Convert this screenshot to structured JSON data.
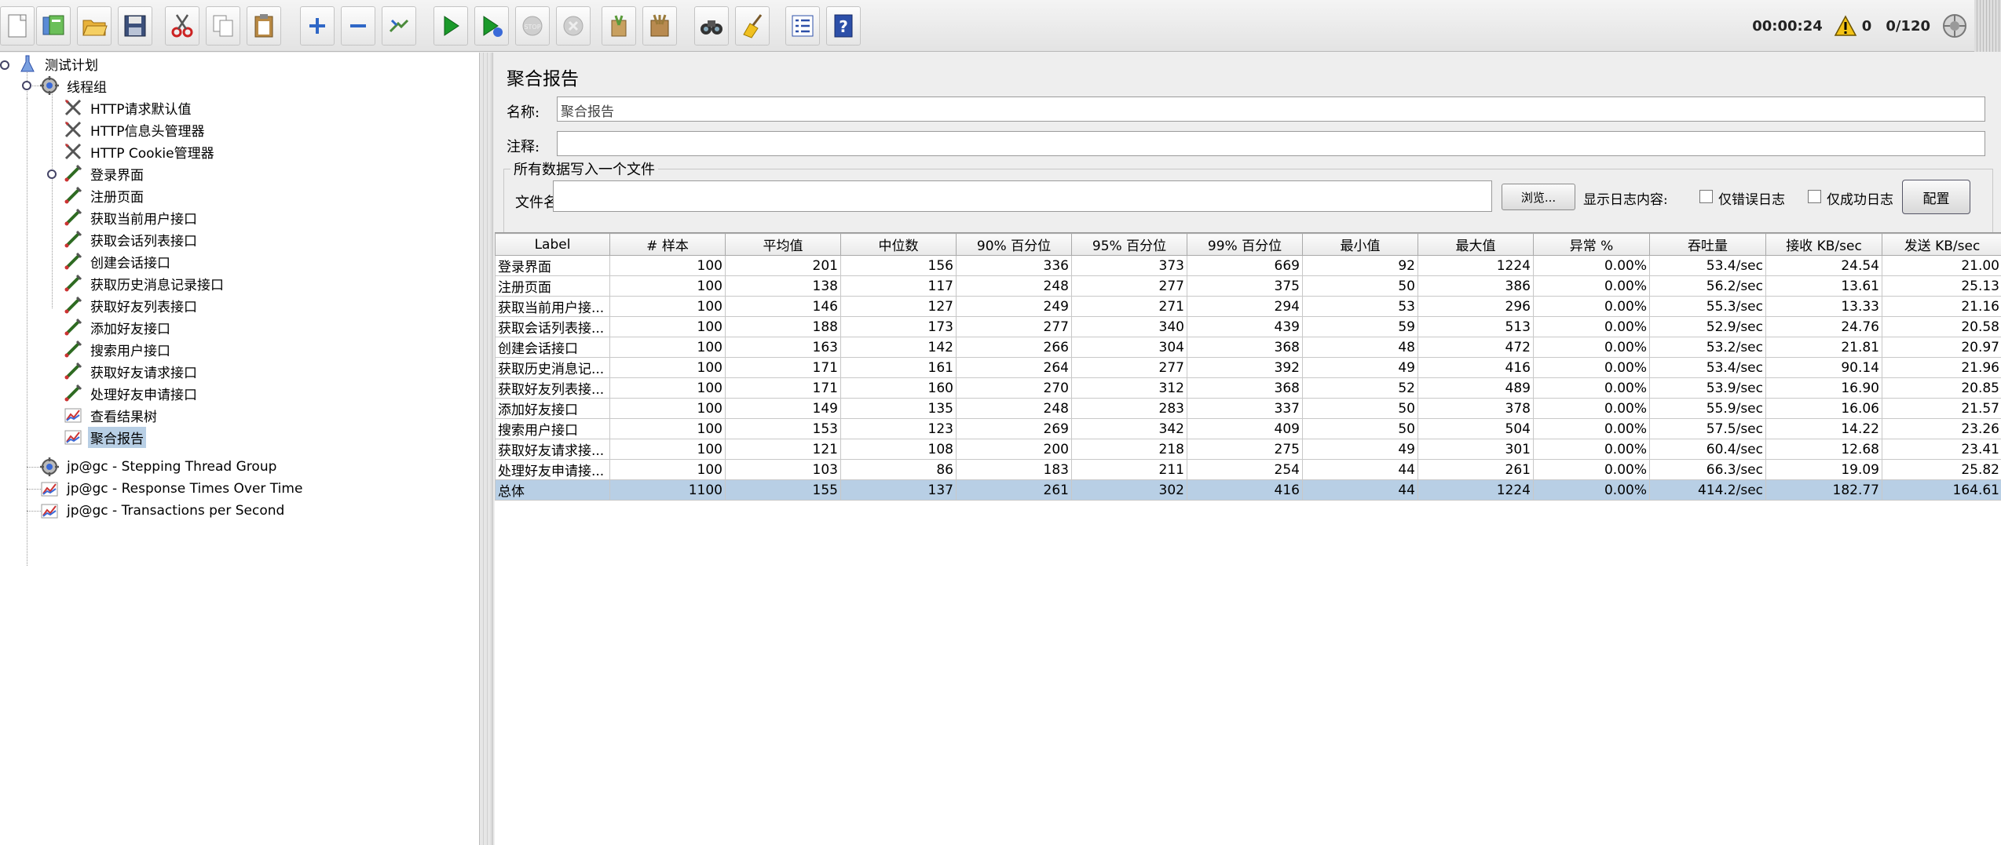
{
  "toolbar": {
    "buttons": [
      {
        "name": "new-icon"
      },
      {
        "name": "templates-icon"
      },
      {
        "name": "open-icon"
      },
      {
        "name": "save-icon"
      },
      {
        "name": "cut-icon"
      },
      {
        "name": "copy-icon"
      },
      {
        "name": "paste-icon"
      },
      {
        "name": "expand-icon"
      },
      {
        "name": "collapse-icon"
      },
      {
        "name": "toggle-icon"
      },
      {
        "name": "start-icon"
      },
      {
        "name": "start-no-pauses-icon"
      },
      {
        "name": "stop-icon"
      },
      {
        "name": "shutdown-icon"
      },
      {
        "name": "clear-icon"
      },
      {
        "name": "clear-all-icon"
      },
      {
        "name": "search-icon"
      },
      {
        "name": "reset-search-icon"
      },
      {
        "name": "function-helper-icon"
      },
      {
        "name": "help-icon"
      }
    ],
    "elapsed": "00:00:24",
    "warnings": "0",
    "threads": "0/120"
  },
  "tree": {
    "items": [
      {
        "label": "测试计划",
        "icon": "test-plan-icon"
      },
      {
        "label": "线程组",
        "icon": "thread-group-icon"
      },
      {
        "label": "HTTP请求默认值",
        "icon": "config-element-icon"
      },
      {
        "label": "HTTP信息头管理器",
        "icon": "config-element-icon"
      },
      {
        "label": "HTTP Cookie管理器",
        "icon": "config-element-icon"
      },
      {
        "label": "登录界面",
        "icon": "sampler-icon"
      },
      {
        "label": "注册页面",
        "icon": "sampler-icon"
      },
      {
        "label": "获取当前用户接口",
        "icon": "sampler-icon"
      },
      {
        "label": "获取会话列表接口",
        "icon": "sampler-icon"
      },
      {
        "label": "创建会话接口",
        "icon": "sampler-icon"
      },
      {
        "label": "获取历史消息记录接口",
        "icon": "sampler-icon"
      },
      {
        "label": "获取好友列表接口",
        "icon": "sampler-icon"
      },
      {
        "label": "添加好友接口",
        "icon": "sampler-icon"
      },
      {
        "label": "搜索用户接口",
        "icon": "sampler-icon"
      },
      {
        "label": "获取好友请求接口",
        "icon": "sampler-icon"
      },
      {
        "label": "处理好友申请接口",
        "icon": "sampler-icon"
      },
      {
        "label": "查看结果树",
        "icon": "listener-icon"
      },
      {
        "label": "聚合报告",
        "icon": "listener-icon"
      },
      {
        "label": "jp@gc - Stepping Thread Group",
        "icon": "thread-group-icon"
      },
      {
        "label": "jp@gc - Response Times Over Time",
        "icon": "listener-icon"
      },
      {
        "label": "jp@gc - Transactions per Second",
        "icon": "listener-icon"
      }
    ]
  },
  "panel": {
    "title": "聚合报告",
    "name_label": "名称:",
    "name_value": "聚合报告",
    "comment_label": "注释:",
    "comment_value": "",
    "file_section_title": "所有数据写入一个文件",
    "file_label": "文件名",
    "file_value": "",
    "browse_label": "浏览...",
    "log_label": "显示日志内容:",
    "errors_only_label": "仅错误日志",
    "success_only_label": "仅成功日志",
    "config_label": "配置"
  },
  "table": {
    "columns": [
      "Label",
      "# 样本",
      "平均值",
      "中位数",
      "90% 百分位",
      "95% 百分位",
      "99% 百分位",
      "最小值",
      "最大值",
      "异常 %",
      "吞吐量",
      "接收 KB/sec",
      "发送 KB/sec"
    ],
    "rows": [
      [
        "登录界面",
        "100",
        "201",
        "156",
        "336",
        "373",
        "669",
        "92",
        "1224",
        "0.00%",
        "53.4/sec",
        "24.54",
        "21.00"
      ],
      [
        "注册页面",
        "100",
        "138",
        "117",
        "248",
        "277",
        "375",
        "50",
        "386",
        "0.00%",
        "56.2/sec",
        "13.61",
        "25.13"
      ],
      [
        "获取当前用户接...",
        "100",
        "146",
        "127",
        "249",
        "271",
        "294",
        "53",
        "296",
        "0.00%",
        "55.3/sec",
        "13.33",
        "21.16"
      ],
      [
        "获取会话列表接...",
        "100",
        "188",
        "173",
        "277",
        "340",
        "439",
        "59",
        "513",
        "0.00%",
        "52.9/sec",
        "24.76",
        "20.58"
      ],
      [
        "创建会话接口",
        "100",
        "163",
        "142",
        "266",
        "304",
        "368",
        "48",
        "472",
        "0.00%",
        "53.2/sec",
        "21.81",
        "20.97"
      ],
      [
        "获取历史消息记...",
        "100",
        "171",
        "161",
        "264",
        "277",
        "392",
        "49",
        "416",
        "0.00%",
        "53.4/sec",
        "90.14",
        "21.96"
      ],
      [
        "获取好友列表接...",
        "100",
        "171",
        "160",
        "270",
        "312",
        "368",
        "52",
        "489",
        "0.00%",
        "53.9/sec",
        "16.90",
        "20.85"
      ],
      [
        "添加好友接口",
        "100",
        "149",
        "135",
        "248",
        "283",
        "337",
        "50",
        "378",
        "0.00%",
        "55.9/sec",
        "16.06",
        "21.57"
      ],
      [
        "搜索用户接口",
        "100",
        "153",
        "123",
        "269",
        "342",
        "409",
        "50",
        "504",
        "0.00%",
        "57.5/sec",
        "14.22",
        "23.26"
      ],
      [
        "获取好友请求接...",
        "100",
        "121",
        "108",
        "200",
        "218",
        "275",
        "49",
        "301",
        "0.00%",
        "60.4/sec",
        "12.68",
        "23.41"
      ],
      [
        "处理好友申请接...",
        "100",
        "103",
        "86",
        "183",
        "211",
        "254",
        "44",
        "261",
        "0.00%",
        "66.3/sec",
        "19.09",
        "25.82"
      ]
    ],
    "total": [
      "总体",
      "1100",
      "155",
      "137",
      "261",
      "302",
      "416",
      "44",
      "1224",
      "0.00%",
      "414.2/sec",
      "182.77",
      "164.61"
    ]
  },
  "colors": {
    "selection": "#b8cfe5",
    "run_green": "#1a9a2a",
    "help_blue": "#2c4fa8"
  }
}
